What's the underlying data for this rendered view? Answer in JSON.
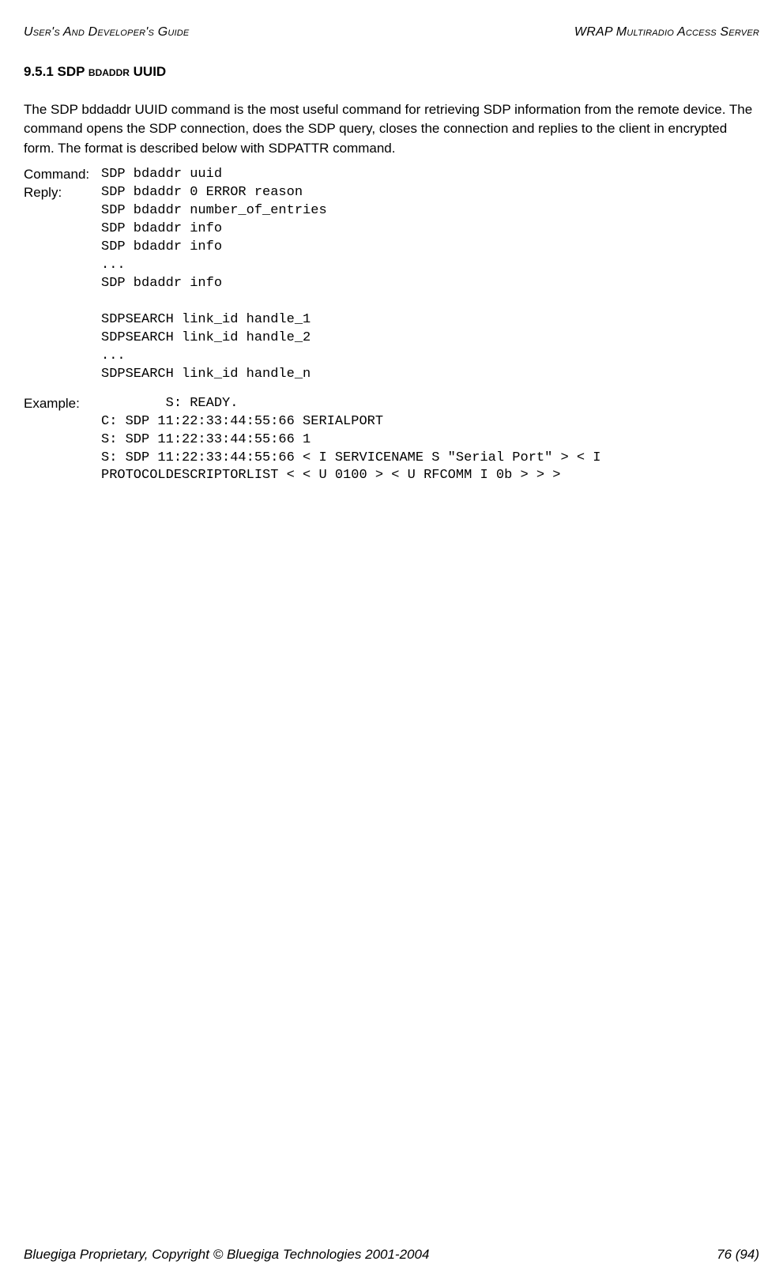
{
  "header": {
    "left": "User's And Developer's Guide",
    "right": "WRAP Multiradio Access Server"
  },
  "section": {
    "num": "9.5.1",
    "title_pre": "SDP ",
    "title_sc": "bdaddr",
    "title_post": " UUID"
  },
  "para": "The SDP bddaddr UUID command is the most useful command for retrieving SDP information from the remote device. The command opens the SDP connection, does the SDP query, closes the connection and replies to the client in encrypted form. The format is described below with SDPATTR command.",
  "command": {
    "label": "Command:",
    "value": "SDP bdaddr uuid"
  },
  "reply": {
    "label": "Reply:",
    "value": "SDP bdaddr 0 ERROR reason\nSDP bdaddr number_of_entries\nSDP bdaddr info\nSDP bdaddr info\n...\nSDP bdaddr info\n\nSDPSEARCH link_id handle_1\nSDPSEARCH link_id handle_2\n...\nSDPSEARCH link_id handle_n"
  },
  "example": {
    "label": "Example:",
    "first_indent": "        S: READY.",
    "rest": "C: SDP 11:22:33:44:55:66 SERIALPORT\nS: SDP 11:22:33:44:55:66 1\nS: SDP 11:22:33:44:55:66 < I SERVICENAME S \"Serial Port\" > < I PROTOCOLDESCRIPTORLIST < < U 0100 > < U RFCOMM I 0b > > >"
  },
  "footer": {
    "left": "Bluegiga Proprietary, Copyright © Bluegiga Technologies 2001-2004",
    "right": "76 (94)"
  }
}
